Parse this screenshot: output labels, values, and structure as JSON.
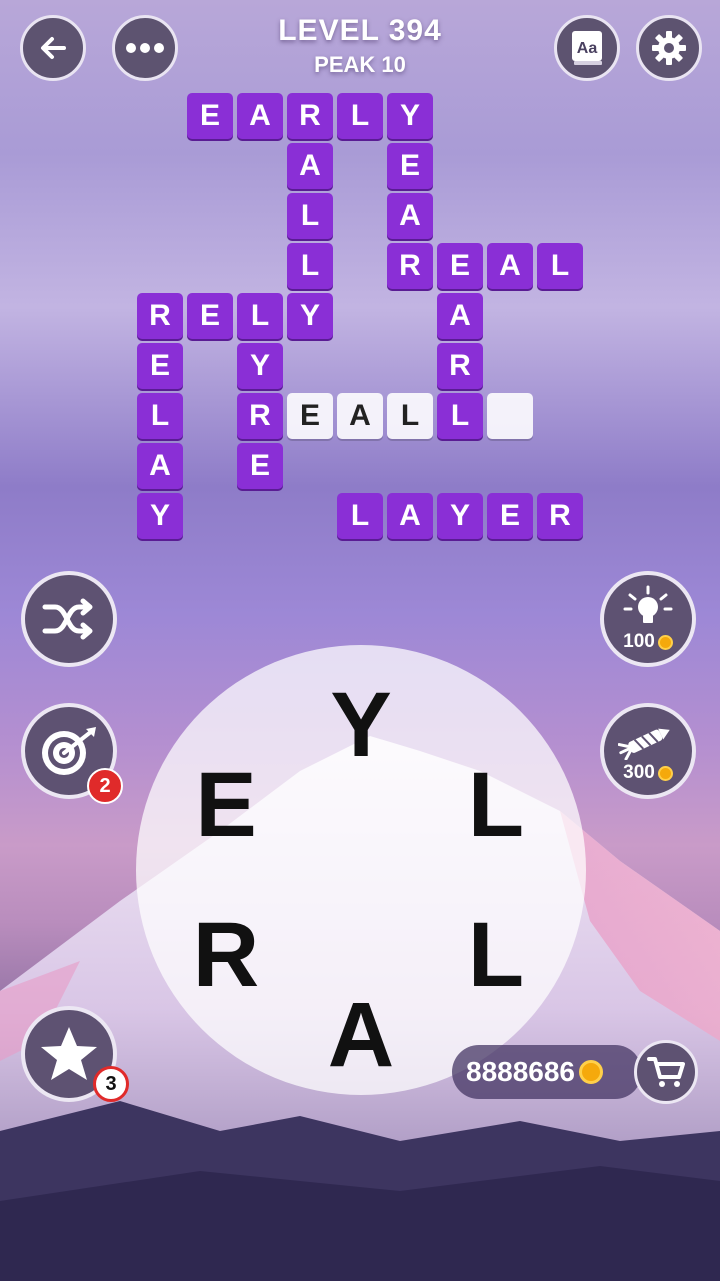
{
  "header": {
    "level": "LEVEL 394",
    "sublevel": "PEAK 10"
  },
  "grid_tiles": [
    {
      "col": 1,
      "row": 0,
      "letter": "E",
      "state": "found"
    },
    {
      "col": 2,
      "row": 0,
      "letter": "A",
      "state": "found"
    },
    {
      "col": 3,
      "row": 0,
      "letter": "R",
      "state": "found"
    },
    {
      "col": 4,
      "row": 0,
      "letter": "L",
      "state": "found"
    },
    {
      "col": 5,
      "row": 0,
      "letter": "Y",
      "state": "found"
    },
    {
      "col": 3,
      "row": 1,
      "letter": "A",
      "state": "found"
    },
    {
      "col": 5,
      "row": 1,
      "letter": "E",
      "state": "found"
    },
    {
      "col": 3,
      "row": 2,
      "letter": "L",
      "state": "found"
    },
    {
      "col": 5,
      "row": 2,
      "letter": "A",
      "state": "found"
    },
    {
      "col": 3,
      "row": 3,
      "letter": "L",
      "state": "found"
    },
    {
      "col": 5,
      "row": 3,
      "letter": "R",
      "state": "found"
    },
    {
      "col": 6,
      "row": 3,
      "letter": "E",
      "state": "found"
    },
    {
      "col": 7,
      "row": 3,
      "letter": "A",
      "state": "found"
    },
    {
      "col": 8,
      "row": 3,
      "letter": "L",
      "state": "found"
    },
    {
      "col": 0,
      "row": 4,
      "letter": "R",
      "state": "found"
    },
    {
      "col": 1,
      "row": 4,
      "letter": "E",
      "state": "found"
    },
    {
      "col": 2,
      "row": 4,
      "letter": "L",
      "state": "found"
    },
    {
      "col": 3,
      "row": 4,
      "letter": "Y",
      "state": "found"
    },
    {
      "col": 6,
      "row": 4,
      "letter": "A",
      "state": "found"
    },
    {
      "col": 0,
      "row": 5,
      "letter": "E",
      "state": "found"
    },
    {
      "col": 2,
      "row": 5,
      "letter": "Y",
      "state": "found"
    },
    {
      "col": 6,
      "row": 5,
      "letter": "R",
      "state": "found"
    },
    {
      "col": 0,
      "row": 6,
      "letter": "L",
      "state": "found"
    },
    {
      "col": 2,
      "row": 6,
      "letter": "R",
      "state": "found"
    },
    {
      "col": 3,
      "row": 6,
      "letter": "E",
      "state": "empty"
    },
    {
      "col": 4,
      "row": 6,
      "letter": "A",
      "state": "empty"
    },
    {
      "col": 5,
      "row": 6,
      "letter": "L",
      "state": "empty"
    },
    {
      "col": 6,
      "row": 6,
      "letter": "L",
      "state": "found"
    },
    {
      "col": 7,
      "row": 6,
      "letter": "",
      "state": "empty"
    },
    {
      "col": 0,
      "row": 7,
      "letter": "A",
      "state": "found"
    },
    {
      "col": 2,
      "row": 7,
      "letter": "E",
      "state": "found"
    },
    {
      "col": 0,
      "row": 8,
      "letter": "Y",
      "state": "found"
    },
    {
      "col": 4,
      "row": 8,
      "letter": "L",
      "state": "found"
    },
    {
      "col": 5,
      "row": 8,
      "letter": "A",
      "state": "found"
    },
    {
      "col": 6,
      "row": 8,
      "letter": "Y",
      "state": "found"
    },
    {
      "col": 7,
      "row": 8,
      "letter": "E",
      "state": "found"
    },
    {
      "col": 8,
      "row": 8,
      "letter": "R",
      "state": "found"
    }
  ],
  "wheel_letters": [
    "Y",
    "L",
    "L",
    "A",
    "R",
    "E"
  ],
  "hints": {
    "hint_cost": "100",
    "rocket_cost": "300",
    "target_badge": "2",
    "star_badge": "3"
  },
  "coins": "8888686",
  "colors": {
    "found_tile": "#8a2fd6",
    "empty_tile": "#ffffff",
    "button_bg": "#5e5272"
  },
  "icons": {
    "back": "arrow-left-icon",
    "menu": "more-dots-icon",
    "dictionary": "dictionary-icon",
    "settings": "gear-icon",
    "shuffle": "shuffle-icon",
    "target": "target-icon",
    "hint": "lightbulb-icon",
    "rocket": "rocket-icon",
    "star": "star-icon",
    "cart": "cart-icon"
  }
}
